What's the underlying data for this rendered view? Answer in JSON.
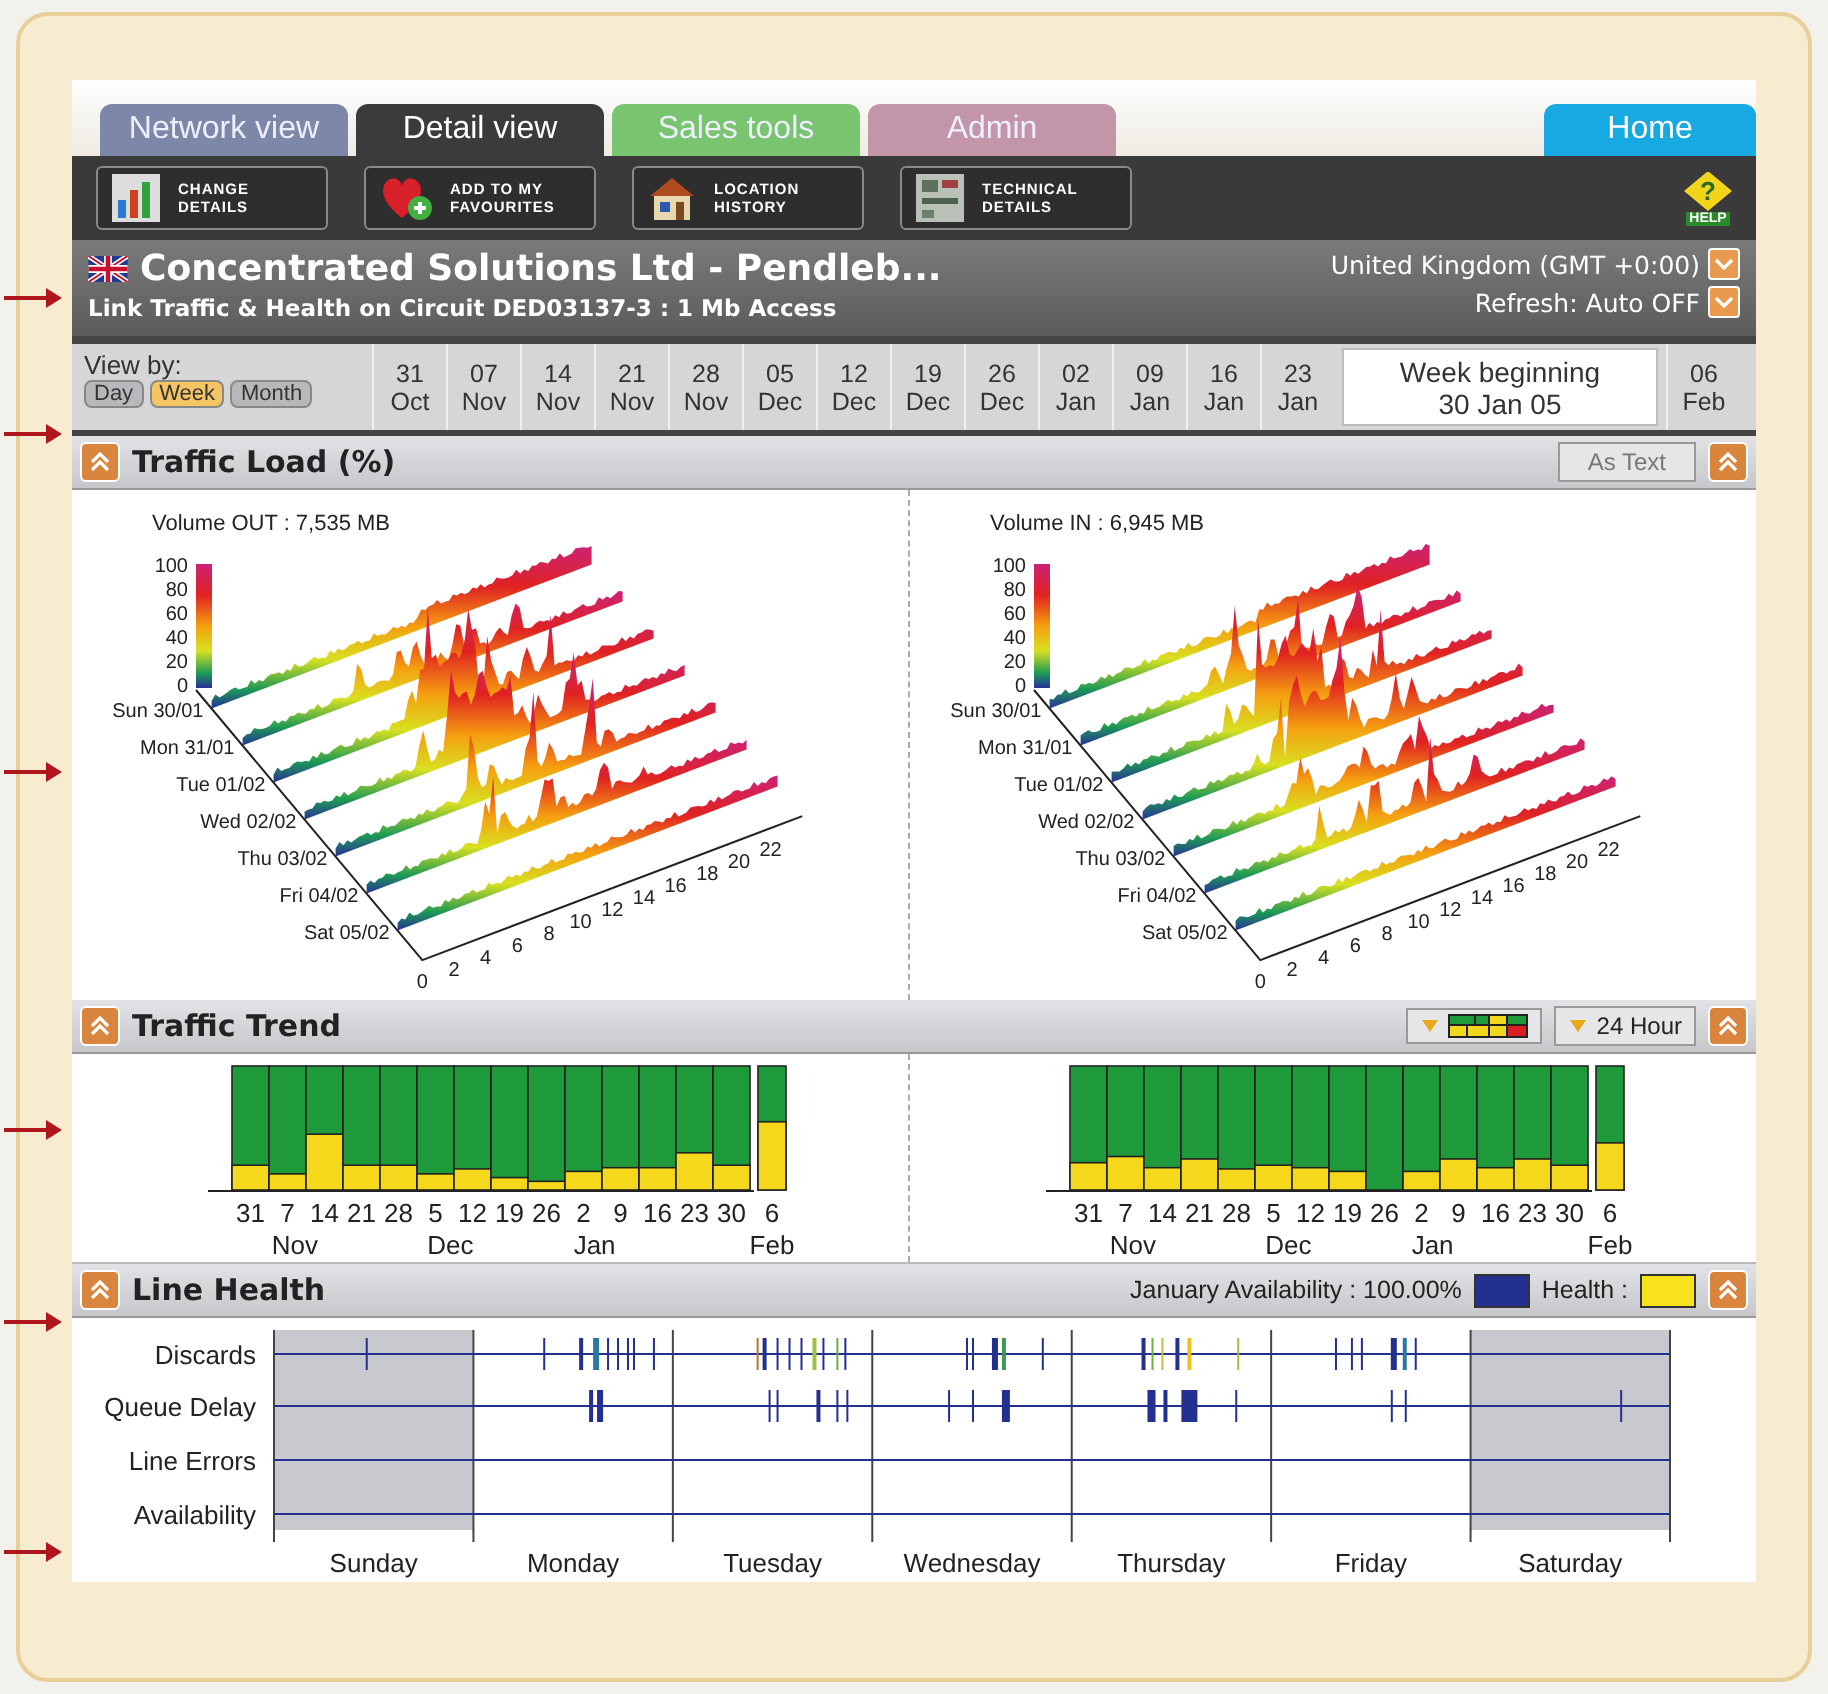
{
  "tabs": [
    {
      "label": "Network view",
      "selected": false,
      "color": "#7d88a8"
    },
    {
      "label": "Detail view",
      "selected": true,
      "color": "#3b3b3b"
    },
    {
      "label": "Sales tools",
      "selected": false,
      "color": "#78c46f"
    },
    {
      "label": "Admin",
      "selected": false,
      "color": "#c295a9"
    }
  ],
  "home_tab": {
    "label": "Home"
  },
  "toolbar": [
    {
      "kind": "chart",
      "label": "CHANGE\nDETAILS"
    },
    {
      "kind": "heart",
      "label": "ADD TO MY\nFAVOURITES"
    },
    {
      "kind": "house",
      "label": "LOCATION\nHISTORY"
    },
    {
      "kind": "panel",
      "label": "TECHNICAL\nDETAILS"
    }
  ],
  "help": {
    "glyph": "?",
    "label": "HELP"
  },
  "header": {
    "title": "Concentrated Solutions Ltd - Pendleb...",
    "subtitle": "Link Traffic & Health on Circuit DED03137-3 : 1 Mb Access",
    "timezone": "United Kingdom (GMT +0:00)",
    "refresh": "Refresh: Auto OFF"
  },
  "view_by": {
    "label": "View by:",
    "options": [
      {
        "label": "Day",
        "selected": false
      },
      {
        "label": "Week",
        "selected": true
      },
      {
        "label": "Month",
        "selected": false
      }
    ]
  },
  "weeks": [
    {
      "label": "31\nOct",
      "selected": false
    },
    {
      "label": "07\nNov",
      "selected": false
    },
    {
      "label": "14\nNov",
      "selected": false
    },
    {
      "label": "21\nNov",
      "selected": false
    },
    {
      "label": "28\nNov",
      "selected": false
    },
    {
      "label": "05\nDec",
      "selected": false
    },
    {
      "label": "12\nDec",
      "selected": false
    },
    {
      "label": "19\nDec",
      "selected": false
    },
    {
      "label": "26\nDec",
      "selected": false
    },
    {
      "label": "02\nJan",
      "selected": false
    },
    {
      "label": "09\nJan",
      "selected": false
    },
    {
      "label": "16\nJan",
      "selected": false
    },
    {
      "label": "23\nJan",
      "selected": false
    },
    {
      "label": "Week beginning\n30 Jan 05",
      "selected": true
    },
    {
      "label": "06\nFeb",
      "selected": false
    }
  ],
  "traffic_load": {
    "title": "Traffic Load (%)",
    "as_text": "As Text",
    "charts": [
      {
        "title": "Volume OUT : 7,535 MB",
        "scale": [
          "100",
          "80",
          "60",
          "40",
          "20",
          "0"
        ],
        "days": [
          "Sun 30/01",
          "Mon 31/01",
          "Tue 01/02",
          "Wed 02/02",
          "Thu 03/02",
          "Fri 04/02",
          "Sat 05/02"
        ],
        "hours": [
          "0",
          "2",
          "4",
          "6",
          "8",
          "10",
          "12",
          "14",
          "16",
          "18",
          "20",
          "22"
        ]
      },
      {
        "title": "Volume IN : 6,945 MB",
        "scale": [
          "100",
          "80",
          "60",
          "40",
          "20",
          "0"
        ],
        "days": [
          "Sun 30/01",
          "Mon 31/01",
          "Tue 01/02",
          "Wed 02/02",
          "Thu 03/02",
          "Fri 04/02",
          "Sat 05/02"
        ],
        "hours": [
          "0",
          "2",
          "4",
          "6",
          "8",
          "10",
          "12",
          "14",
          "16",
          "18",
          "20",
          "22"
        ]
      }
    ]
  },
  "traffic_trend": {
    "title": "Traffic Trend",
    "period": "24 Hour",
    "charts": [
      {
        "ticks": [
          "31",
          "7",
          "14",
          "21",
          "28",
          "5",
          "12",
          "19",
          "26",
          "2",
          "9",
          "16",
          "23",
          "30",
          "6"
        ],
        "months": [
          "Nov",
          "Dec",
          "Jan",
          "Feb"
        ]
      },
      {
        "ticks": [
          "31",
          "7",
          "14",
          "21",
          "28",
          "5",
          "12",
          "19",
          "26",
          "2",
          "9",
          "16",
          "23",
          "30",
          "6"
        ],
        "months": [
          "Nov",
          "Dec",
          "Jan",
          "Feb"
        ]
      }
    ]
  },
  "line_health": {
    "title": "Line Health",
    "availability": "January Availability : 100.00%",
    "health": "Health :",
    "rows": [
      "Discards",
      "Queue Delay",
      "Line Errors",
      "Availability"
    ],
    "days": [
      "Sunday",
      "Monday",
      "Tuesday",
      "Wednesday",
      "Thursday",
      "Friday",
      "Saturday"
    ]
  }
}
